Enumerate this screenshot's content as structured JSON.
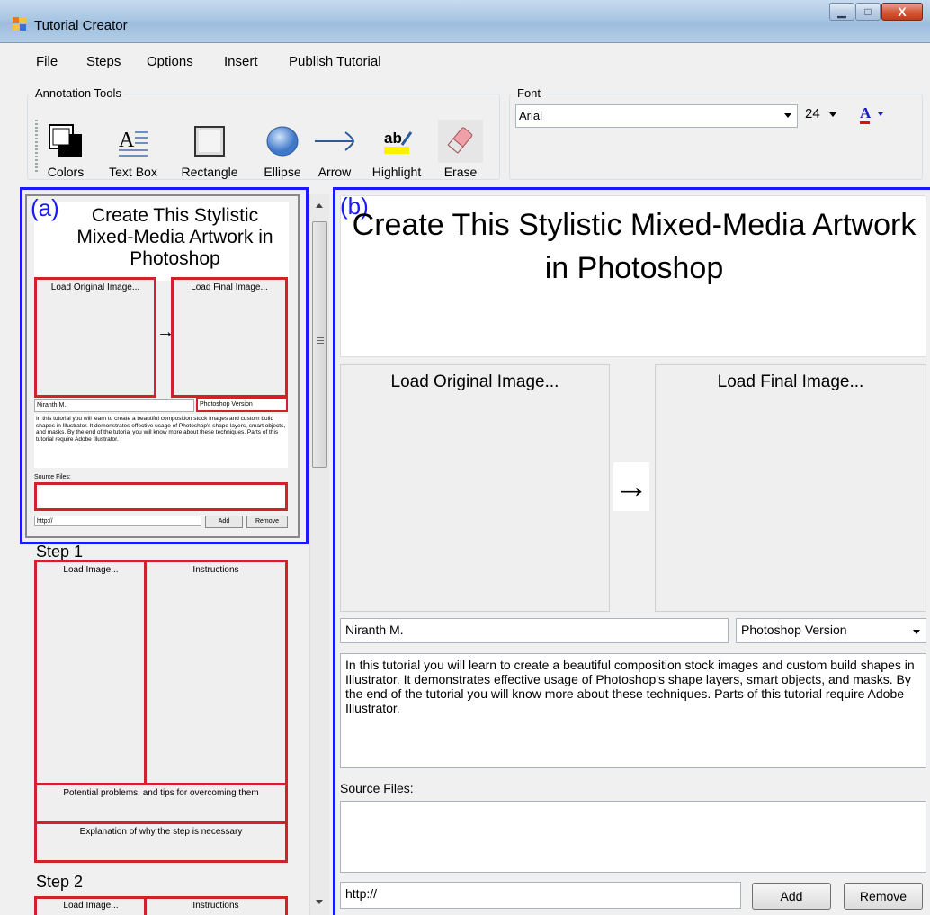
{
  "window": {
    "title": "Tutorial Creator",
    "minimize": "▁",
    "maximize": "□",
    "close": "X"
  },
  "menu": [
    "File",
    "Steps",
    "Options",
    "Insert",
    "Publish Tutorial"
  ],
  "annotation_tools": {
    "label": "Annotation Tools",
    "tools": [
      "Colors",
      "Text Box",
      "Rectangle",
      "Ellipse",
      "Arrow",
      "Highlight",
      "Erase"
    ]
  },
  "font": {
    "label": "Font",
    "family": "Arial",
    "size": "24",
    "color_glyph": "A"
  },
  "thumbnail": {
    "marker": "(a)",
    "title": "Create This Stylistic Mixed-Media Artwork in Photoshop",
    "load_original": "Load Original Image...",
    "load_final": "Load Final Image...",
    "author": "Niranth M.",
    "version": "Photoshop Version",
    "description": "In this tutorial you will learn to create a beautiful composition stock images and custom build shapes in Illustrator. It demonstrates effective usage of Photoshop's shape layers, smart objects, and masks. By the end of the tutorial you will know more about these techniques. Parts of this tutorial require Adobe Illustrator.",
    "source_label": "Source Files:",
    "url": "http://",
    "add": "Add",
    "remove": "Remove",
    "arrow": "→"
  },
  "steps": [
    {
      "title": "Step 1",
      "load": "Load Image...",
      "instructions": "Instructions",
      "problems": "Potential problems, and tips for overcoming them",
      "explanation": "Explanation of why the step is necessary"
    },
    {
      "title": "Step 2",
      "load": "Load Image...",
      "instructions": "Instructions"
    }
  ],
  "main": {
    "marker": "(b)",
    "title": "Create This Stylistic Mixed-Media Artwork in Photoshop",
    "load_original": "Load Original Image...",
    "load_final": "Load Final Image...",
    "arrow": "→",
    "author": "Niranth M.",
    "version": "Photoshop Version",
    "description": "In this tutorial you will learn to create a beautiful composition stock images and custom build shapes in Illustrator. It demonstrates effective usage of Photoshop's shape layers, smart objects, and masks. By the end of the tutorial you will know more about these techniques. Parts of this tutorial require Adobe Illustrator.",
    "source_label": "Source Files:",
    "url": "http://",
    "add": "Add",
    "remove": "Remove"
  },
  "colors": {
    "accent_blue": "#1a1aff",
    "frame_red": "#d0222a"
  }
}
